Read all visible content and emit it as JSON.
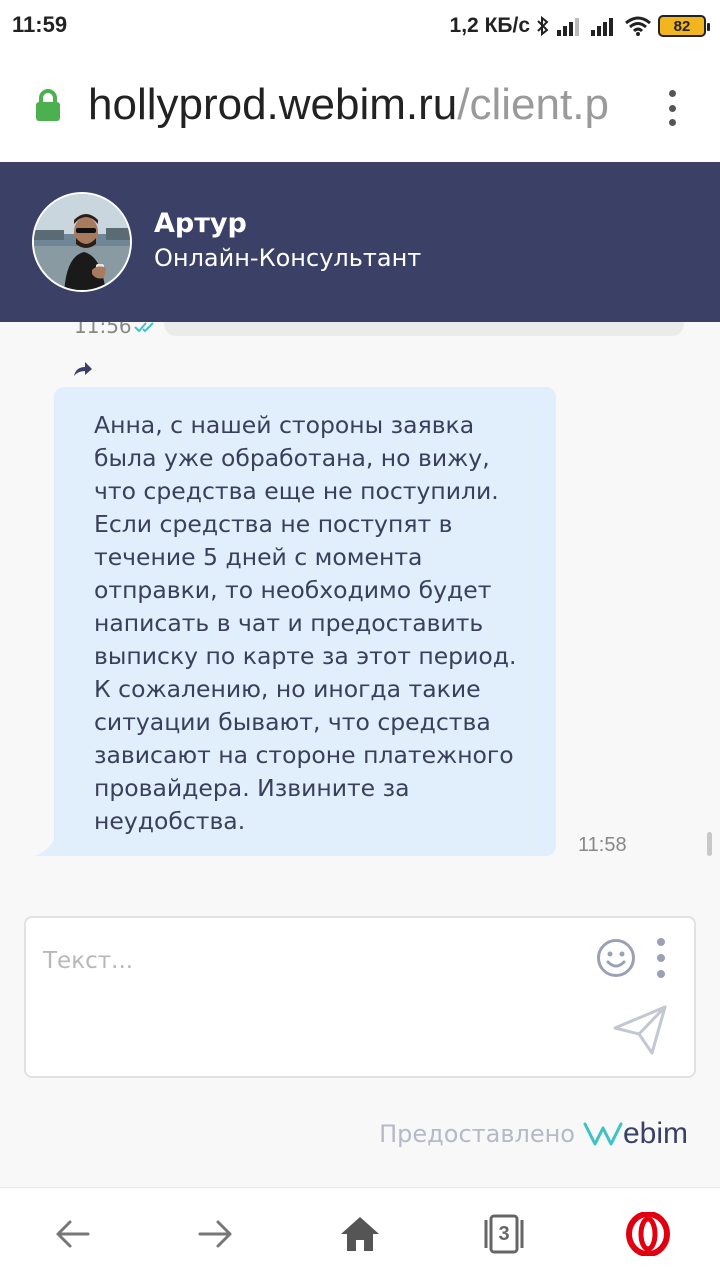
{
  "status_bar": {
    "time": "11:59",
    "network_speed": "1,2 КБ/с",
    "battery_level": "82"
  },
  "browser": {
    "url_domain": "hollyprod.webim.ru",
    "url_path": "/client.p",
    "tab_count": "3"
  },
  "chat_header": {
    "agent_name": "Артур",
    "agent_role": "Онлайн-Консультант"
  },
  "chat": {
    "previous_message_time": "11:56",
    "message_text": "Анна, с нашей стороны заявка была уже обработана, но вижу, что средства еще не поступили. Если средства не поступят в течение 5 дней с момента отправки, то необходимо будет написать в чат и предоставить выписку по карте за этот период. К сожалению, но иногда такие ситуации бывают, что средства зависают на стороне платежного провайдера. Извините за неудобства.",
    "message_time": "11:58"
  },
  "composer": {
    "placeholder": "Текст..."
  },
  "footer": {
    "powered_by": "Предоставлено",
    "brand_rest": "ebim"
  },
  "colors": {
    "header_bg": "#3b4066",
    "bubble_bg": "#e1eefb",
    "chat_bg": "#f8f8f8",
    "lock_green": "#4caf50",
    "opera_red": "#e0000f",
    "read_check": "#3cc3c8"
  },
  "icons": [
    "lock-icon",
    "browser-menu-icon",
    "double-check-icon",
    "forward-icon",
    "emoji-icon",
    "more-options-icon",
    "send-icon",
    "back-arrow-icon",
    "forward-arrow-icon",
    "home-icon",
    "tabs-icon",
    "opera-icon"
  ]
}
